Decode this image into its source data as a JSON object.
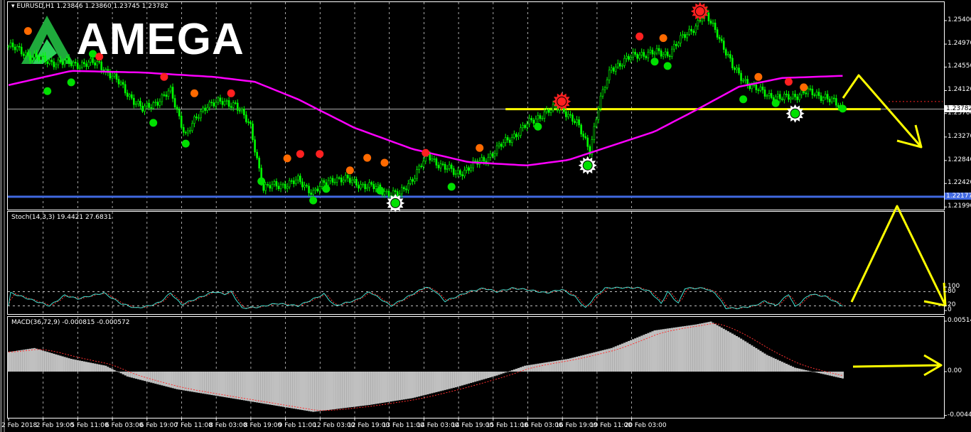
{
  "header": {
    "symbol": "EURUSD,H1",
    "quote": "1.23846 1.23860 1.23745 1.23782"
  },
  "logo": {
    "text": "AMEGA"
  },
  "colors": {
    "background": "#000000",
    "candles": "#00ff00",
    "moving_average": "#ff00ff",
    "support_line": "#ffff00",
    "level_line": "#4169e1",
    "stoch_main": "#40e0d0",
    "stoch_signal": "#ff3030",
    "macd_hist": "#c0c0c0",
    "macd_signal": "#ff3030",
    "marker_top": "#ff2020",
    "marker_top_alt": "#ff6a00",
    "marker_bottom": "#00e000",
    "annotation": "#ffff00"
  },
  "price_axis": {
    "labels": [
      "1.25400",
      "1.24970",
      "1.24550",
      "1.24120",
      "1.23700",
      "1.23270",
      "1.22840",
      "1.22420",
      "1.21990"
    ],
    "bid_tag": "1.23782",
    "level_tag": "1.22177"
  },
  "stoch": {
    "title": "Stoch(14,3,3) 19.4421 27.6831",
    "axis_labels": [
      "100",
      "80",
      "20",
      "0"
    ]
  },
  "macd": {
    "title": "MACD(36,72,9) -0.000815 -0.000572",
    "axis_labels": [
      "0.00514",
      "0.00",
      "-0.00446"
    ]
  },
  "time_axis": {
    "labels": [
      "2 Feb 2018",
      "2 Feb 19:00",
      "5 Feb 11:00",
      "6 Feb 03:00",
      "6 Feb 19:00",
      "7 Feb 11:00",
      "8 Feb 03:00",
      "8 Feb 19:00",
      "9 Feb 11:00",
      "12 Feb 03:00",
      "12 Feb 19:00",
      "13 Feb 11:00",
      "14 Feb 03:00",
      "14 Feb 19:00",
      "15 Feb 11:00",
      "16 Feb 03:00",
      "16 Feb 19:00",
      "19 Feb 11:00",
      "20 Feb 03:00"
    ]
  },
  "chart_data": {
    "type": "line",
    "title": "EURUSD,H1",
    "x_unit": "bar index (H1)",
    "price_range": [
      1.2199,
      1.256
    ],
    "price_keypoints": [
      [
        0,
        1.2493
      ],
      [
        16,
        1.2467
      ],
      [
        29,
        1.2461
      ],
      [
        42,
        1.2461
      ],
      [
        52,
        1.2422
      ],
      [
        62,
        1.2376
      ],
      [
        75,
        1.2409
      ],
      [
        82,
        1.2331
      ],
      [
        92,
        1.2389
      ],
      [
        105,
        1.2389
      ],
      [
        112,
        1.2344
      ],
      [
        118,
        1.2233
      ],
      [
        134,
        1.2246
      ],
      [
        141,
        1.2227
      ],
      [
        151,
        1.2253
      ],
      [
        164,
        1.224
      ],
      [
        181,
        1.222
      ],
      [
        194,
        1.2292
      ],
      [
        207,
        1.2259
      ],
      [
        220,
        1.2285
      ],
      [
        234,
        1.2331
      ],
      [
        247,
        1.237
      ],
      [
        256,
        1.2383
      ],
      [
        263,
        1.235
      ],
      [
        269,
        1.2305
      ],
      [
        273,
        1.2383
      ],
      [
        279,
        1.2454
      ],
      [
        292,
        1.248
      ],
      [
        305,
        1.248
      ],
      [
        318,
        1.2532
      ],
      [
        322,
        1.2552
      ],
      [
        328,
        1.2519
      ],
      [
        335,
        1.2454
      ],
      [
        345,
        1.2415
      ],
      [
        358,
        1.2396
      ],
      [
        368,
        1.2409
      ],
      [
        378,
        1.2402
      ],
      [
        386,
        1.2376
      ]
    ],
    "ma_keypoints": [
      [
        0,
        1.2422
      ],
      [
        29,
        1.2448
      ],
      [
        62,
        1.2445
      ],
      [
        95,
        1.2437
      ],
      [
        114,
        1.2428
      ],
      [
        134,
        1.2396
      ],
      [
        160,
        1.2344
      ],
      [
        187,
        1.2305
      ],
      [
        213,
        1.2281
      ],
      [
        240,
        1.2275
      ],
      [
        259,
        1.2285
      ],
      [
        279,
        1.2311
      ],
      [
        299,
        1.2337
      ],
      [
        318,
        1.2376
      ],
      [
        338,
        1.2419
      ],
      [
        358,
        1.2435
      ],
      [
        386,
        1.2439
      ]
    ],
    "markers_bottom": [
      [
        18,
        1.2411
      ],
      [
        29,
        1.2427
      ],
      [
        39,
        1.2479
      ],
      [
        67,
        1.2353
      ],
      [
        82,
        1.2315
      ],
      [
        117,
        1.2246
      ],
      [
        141,
        1.2211
      ],
      [
        147,
        1.2232
      ],
      [
        172,
        1.2229
      ],
      [
        179,
        1.2206,
        "big"
      ],
      [
        205,
        1.2236
      ],
      [
        245,
        1.2346
      ],
      [
        268,
        1.2275,
        "big"
      ],
      [
        299,
        1.2465
      ],
      [
        305,
        1.2457
      ],
      [
        340,
        1.2396
      ],
      [
        355,
        1.2389
      ],
      [
        364,
        1.237,
        "big"
      ],
      [
        386,
        1.2379
      ]
    ],
    "markers_top": [
      [
        9,
        1.2521,
        "alt"
      ],
      [
        42,
        1.2474
      ],
      [
        72,
        1.2437
      ],
      [
        86,
        1.2407,
        "alt"
      ],
      [
        103,
        1.2407
      ],
      [
        129,
        1.2288,
        "alt"
      ],
      [
        135,
        1.2296
      ],
      [
        144,
        1.2296
      ],
      [
        158,
        1.2266,
        "alt"
      ],
      [
        166,
        1.2289,
        "alt"
      ],
      [
        174,
        1.228,
        "alt"
      ],
      [
        193,
        1.2298
      ],
      [
        218,
        1.2307,
        "alt"
      ],
      [
        256,
        1.2392,
        "big"
      ],
      [
        292,
        1.2511
      ],
      [
        303,
        1.2508,
        "alt"
      ],
      [
        320,
        1.2557,
        "big"
      ],
      [
        347,
        1.2437,
        "alt"
      ],
      [
        361,
        1.2428
      ],
      [
        368,
        1.2418,
        "alt"
      ]
    ],
    "levels": {
      "blue_level": 1.22177,
      "support": 1.2378,
      "support_from_bar": 230,
      "support_to_bar": 397,
      "bid": 1.23782,
      "red_dotted": 1.2392
    },
    "stoch_keypoints": [
      [
        1,
        75
      ],
      [
        19,
        20
      ],
      [
        26,
        65
      ],
      [
        32,
        50
      ],
      [
        39,
        65
      ],
      [
        44,
        75
      ],
      [
        52,
        30
      ],
      [
        59,
        10
      ],
      [
        65,
        20
      ],
      [
        70,
        35
      ],
      [
        75,
        75
      ],
      [
        80,
        25
      ],
      [
        95,
        80
      ],
      [
        100,
        70
      ],
      [
        103,
        80
      ],
      [
        108,
        10
      ],
      [
        116,
        15
      ],
      [
        124,
        30
      ],
      [
        134,
        20
      ],
      [
        146,
        70
      ],
      [
        151,
        20
      ],
      [
        161,
        45
      ],
      [
        167,
        80
      ],
      [
        177,
        20
      ],
      [
        187,
        70
      ],
      [
        193,
        100
      ],
      [
        197,
        85
      ],
      [
        202,
        40
      ],
      [
        213,
        80
      ],
      [
        220,
        95
      ],
      [
        226,
        80
      ],
      [
        233,
        95
      ],
      [
        239,
        90
      ],
      [
        249,
        75
      ],
      [
        256,
        90
      ],
      [
        262,
        60
      ],
      [
        267,
        10
      ],
      [
        271,
        55
      ],
      [
        276,
        95
      ],
      [
        282,
        98
      ],
      [
        292,
        96
      ],
      [
        297,
        80
      ],
      [
        302,
        30
      ],
      [
        305,
        80
      ],
      [
        310,
        30
      ],
      [
        313,
        95
      ],
      [
        322,
        95
      ],
      [
        327,
        75
      ],
      [
        332,
        10
      ],
      [
        338,
        10
      ],
      [
        345,
        20
      ],
      [
        350,
        40
      ],
      [
        355,
        20
      ],
      [
        361,
        70
      ],
      [
        364,
        15
      ],
      [
        371,
        70
      ],
      [
        378,
        60
      ],
      [
        386,
        20
      ]
    ],
    "stoch_range": [
      0,
      100
    ],
    "macd_keypoints": [
      [
        0,
        0.002
      ],
      [
        12,
        0.0024
      ],
      [
        29,
        0.0013
      ],
      [
        45,
        0.0006
      ],
      [
        55,
        -0.0005
      ],
      [
        78,
        -0.0018
      ],
      [
        111,
        -0.003
      ],
      [
        141,
        -0.0041
      ],
      [
        167,
        -0.0034
      ],
      [
        187,
        -0.0027
      ],
      [
        207,
        -0.0016
      ],
      [
        226,
        -0.0004
      ],
      [
        239,
        0.0006
      ],
      [
        259,
        0.0013
      ],
      [
        279,
        0.0024
      ],
      [
        299,
        0.0042
      ],
      [
        318,
        0.0048
      ],
      [
        325,
        0.0051
      ],
      [
        338,
        0.0035
      ],
      [
        351,
        0.0017
      ],
      [
        364,
        0.0004
      ],
      [
        374,
        -0.0001
      ],
      [
        386,
        -0.0007
      ]
    ],
    "macd_range": [
      -0.00446,
      0.00514
    ]
  }
}
